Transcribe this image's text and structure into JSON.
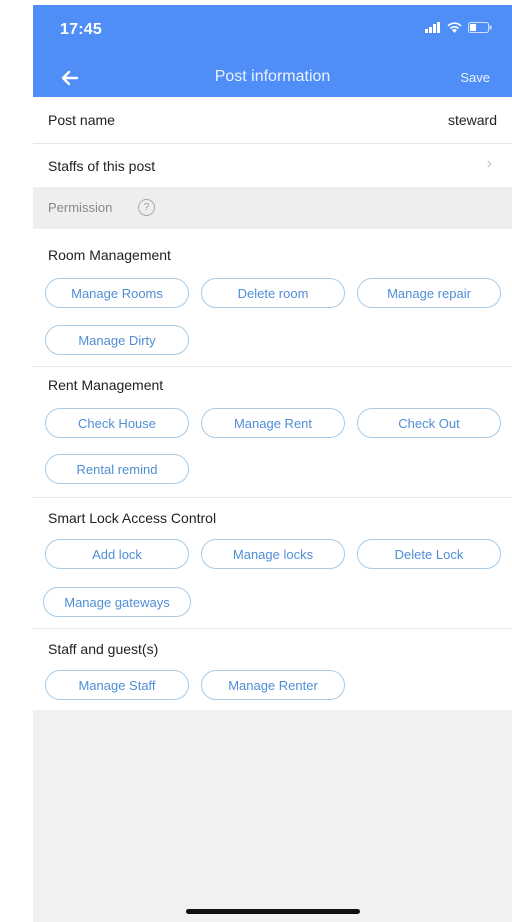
{
  "status": {
    "time": "17:45"
  },
  "nav": {
    "title": "Post information",
    "save": "Save"
  },
  "post_name": {
    "label": "Post name",
    "value": "steward"
  },
  "staffs": {
    "label": "Staffs of this post"
  },
  "permission": {
    "label": "Permission",
    "help": "?"
  },
  "sections": [
    {
      "title": "Room Management",
      "items": [
        "Manage Rooms",
        "Delete room",
        "Manage repair",
        "Manage Dirty"
      ]
    },
    {
      "title": "Rent Management",
      "items": [
        "Check House",
        "Manage Rent",
        "Check Out",
        "Rental remind"
      ]
    },
    {
      "title": "Smart Lock Access Control",
      "items": [
        "Add lock",
        "Manage locks",
        "Delete Lock",
        "Manage gateways"
      ]
    },
    {
      "title": "Staff and guest(s)",
      "items": [
        "Manage Staff",
        "Manage Renter"
      ]
    }
  ],
  "colors": {
    "header": "#4f8ef7",
    "chip_text": "#4f8ed6",
    "chip_border": "#a9cbe6"
  }
}
